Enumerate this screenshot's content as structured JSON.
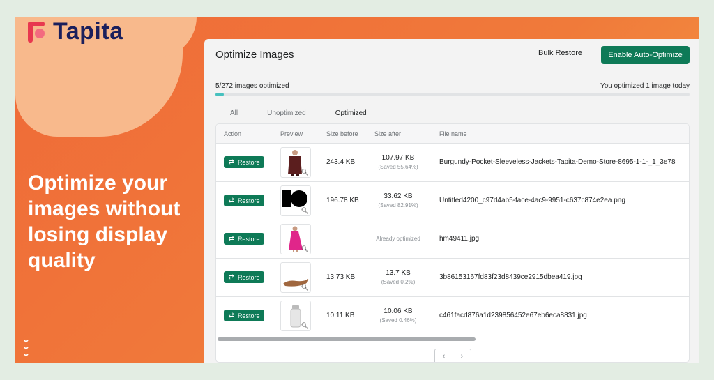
{
  "brand": {
    "name": "Tapita"
  },
  "promo": {
    "headline": "Optimize your images without losing display quality",
    "chevrons": "⌄⌄⌄"
  },
  "header": {
    "title": "Optimize Images",
    "bulk_restore": "Bulk Restore",
    "enable_button": "Enable Auto-Optimize"
  },
  "progress": {
    "label": "5/272 images optimized",
    "today": "You optimized 1 image today",
    "fraction": 0.018
  },
  "tabs": [
    {
      "label": "All",
      "active": false
    },
    {
      "label": "Unoptimized",
      "active": false
    },
    {
      "label": "Optimized",
      "active": true
    }
  ],
  "table": {
    "columns": [
      "Action",
      "Preview",
      "Size before",
      "Size after",
      "File name"
    ],
    "restore_label": "Restore",
    "rows": [
      {
        "size_before": "243.4 KB",
        "size_after": "107.97 KB",
        "saved": "(Saved 55.64%)",
        "status": "",
        "file": "Burgundy-Pocket-Sleeveless-Jackets-Tapita-Demo-Store-8695-1-1-_1_3e78",
        "preview": "burgundy-jacket"
      },
      {
        "size_before": "196.78 KB",
        "size_after": "33.62 KB",
        "saved": "(Saved 82.91%)",
        "status": "",
        "file": "Untitled4200_c97d4ab5-face-4ac9-9951-c637c874e2ea.png",
        "preview": "black-shapes"
      },
      {
        "size_before": "",
        "size_after": "",
        "saved": "",
        "status": "Already optimized",
        "file": "hm49411.jpg",
        "preview": "pink-dress"
      },
      {
        "size_before": "13.73 KB",
        "size_after": "13.7 KB",
        "saved": "(Saved 0.2%)",
        "status": "",
        "file": "3b86153167fd83f23d8439ce2915dbea419.jpg",
        "preview": "brown-insole"
      },
      {
        "size_before": "10.11 KB",
        "size_after": "10.06 KB",
        "saved": "(Saved 0.46%)",
        "status": "",
        "file": "c461facd876a1d239856452e67eb6eca8831.jpg",
        "preview": "white-bottle"
      }
    ]
  },
  "pagination": {
    "prev": "‹",
    "next": "›"
  },
  "colors": {
    "accent": "#0e7a57",
    "orange": "#ef6a38",
    "progress": "#47c1bf"
  }
}
